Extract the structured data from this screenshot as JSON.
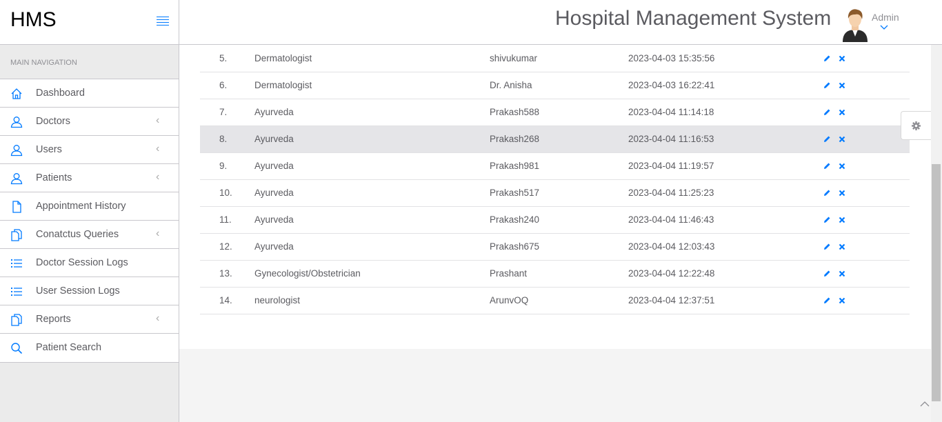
{
  "brand": {
    "name": "HMS"
  },
  "header": {
    "title": "Hospital Management System",
    "user": "Admin"
  },
  "sidebar": {
    "heading": "MAIN NAVIGATION",
    "items": [
      {
        "label": "Dashboard",
        "icon": "home-icon",
        "chevron": false
      },
      {
        "label": "Doctors",
        "icon": "user-icon",
        "chevron": true
      },
      {
        "label": "Users",
        "icon": "user-icon",
        "chevron": true
      },
      {
        "label": "Patients",
        "icon": "user-icon",
        "chevron": true
      },
      {
        "label": "Appointment History",
        "icon": "file-icon",
        "chevron": false
      },
      {
        "label": "Conatctus Queries",
        "icon": "files-icon",
        "chevron": true
      },
      {
        "label": "Doctor Session Logs",
        "icon": "list-icon",
        "chevron": false
      },
      {
        "label": "User Session Logs",
        "icon": "list-icon",
        "chevron": false
      },
      {
        "label": "Reports",
        "icon": "files-icon",
        "chevron": true
      },
      {
        "label": "Patient Search",
        "icon": "search-icon",
        "chevron": false
      }
    ]
  },
  "table": {
    "rows": [
      {
        "num": "5.",
        "specialization": "Dermatologist",
        "doctor": "shivukumar",
        "date": "2023-04-03 15:35:56"
      },
      {
        "num": "6.",
        "specialization": "Dermatologist",
        "doctor": "Dr. Anisha",
        "date": "2023-04-03 16:22:41"
      },
      {
        "num": "7.",
        "specialization": "Ayurveda",
        "doctor": "Prakash588",
        "date": "2023-04-04 11:14:18"
      },
      {
        "num": "8.",
        "specialization": "Ayurveda",
        "doctor": "Prakash268",
        "date": "2023-04-04 11:16:53"
      },
      {
        "num": "9.",
        "specialization": "Ayurveda",
        "doctor": "Prakash981",
        "date": "2023-04-04 11:19:57"
      },
      {
        "num": "10.",
        "specialization": "Ayurveda",
        "doctor": "Prakash517",
        "date": "2023-04-04 11:25:23"
      },
      {
        "num": "11.",
        "specialization": "Ayurveda",
        "doctor": "Prakash240",
        "date": "2023-04-04 11:46:43"
      },
      {
        "num": "12.",
        "specialization": "Ayurveda",
        "doctor": "Prakash675",
        "date": "2023-04-04 12:03:43"
      },
      {
        "num": "13.",
        "specialization": "Gynecologist/Obstetrician",
        "doctor": "Prashant",
        "date": "2023-04-04 12:22:48"
      },
      {
        "num": "14.",
        "specialization": "neurologist",
        "doctor": "ArunvOQ",
        "date": "2023-04-04 12:37:51"
      }
    ],
    "highlighted_row": "8."
  },
  "colors": {
    "accent": "#007aff",
    "text": "#5b5b60",
    "border": "#c8c7cc"
  }
}
